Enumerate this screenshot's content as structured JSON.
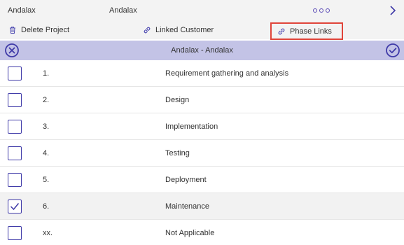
{
  "topbar": {
    "left_label": "Andalax",
    "middle_label": "Andalax"
  },
  "actions": {
    "delete_project": "Delete Project",
    "linked_customer": "Linked Customer",
    "phase_links": "Phase Links"
  },
  "header": {
    "title": "Andalax - Andalax"
  },
  "colors": {
    "accent": "#3f3aa8",
    "header_bg": "#c3c3e6",
    "highlight_border": "#e0443a"
  },
  "phases": [
    {
      "num": "1.",
      "label": "Requirement gathering and analysis",
      "checked": false
    },
    {
      "num": "2.",
      "label": "Design",
      "checked": false
    },
    {
      "num": "3.",
      "label": "Implementation",
      "checked": false
    },
    {
      "num": "4.",
      "label": "Testing",
      "checked": false
    },
    {
      "num": "5.",
      "label": "Deployment",
      "checked": false
    },
    {
      "num": "6.",
      "label": "Maintenance",
      "checked": true
    },
    {
      "num": "xx.",
      "label": "Not Applicable",
      "checked": false
    }
  ]
}
